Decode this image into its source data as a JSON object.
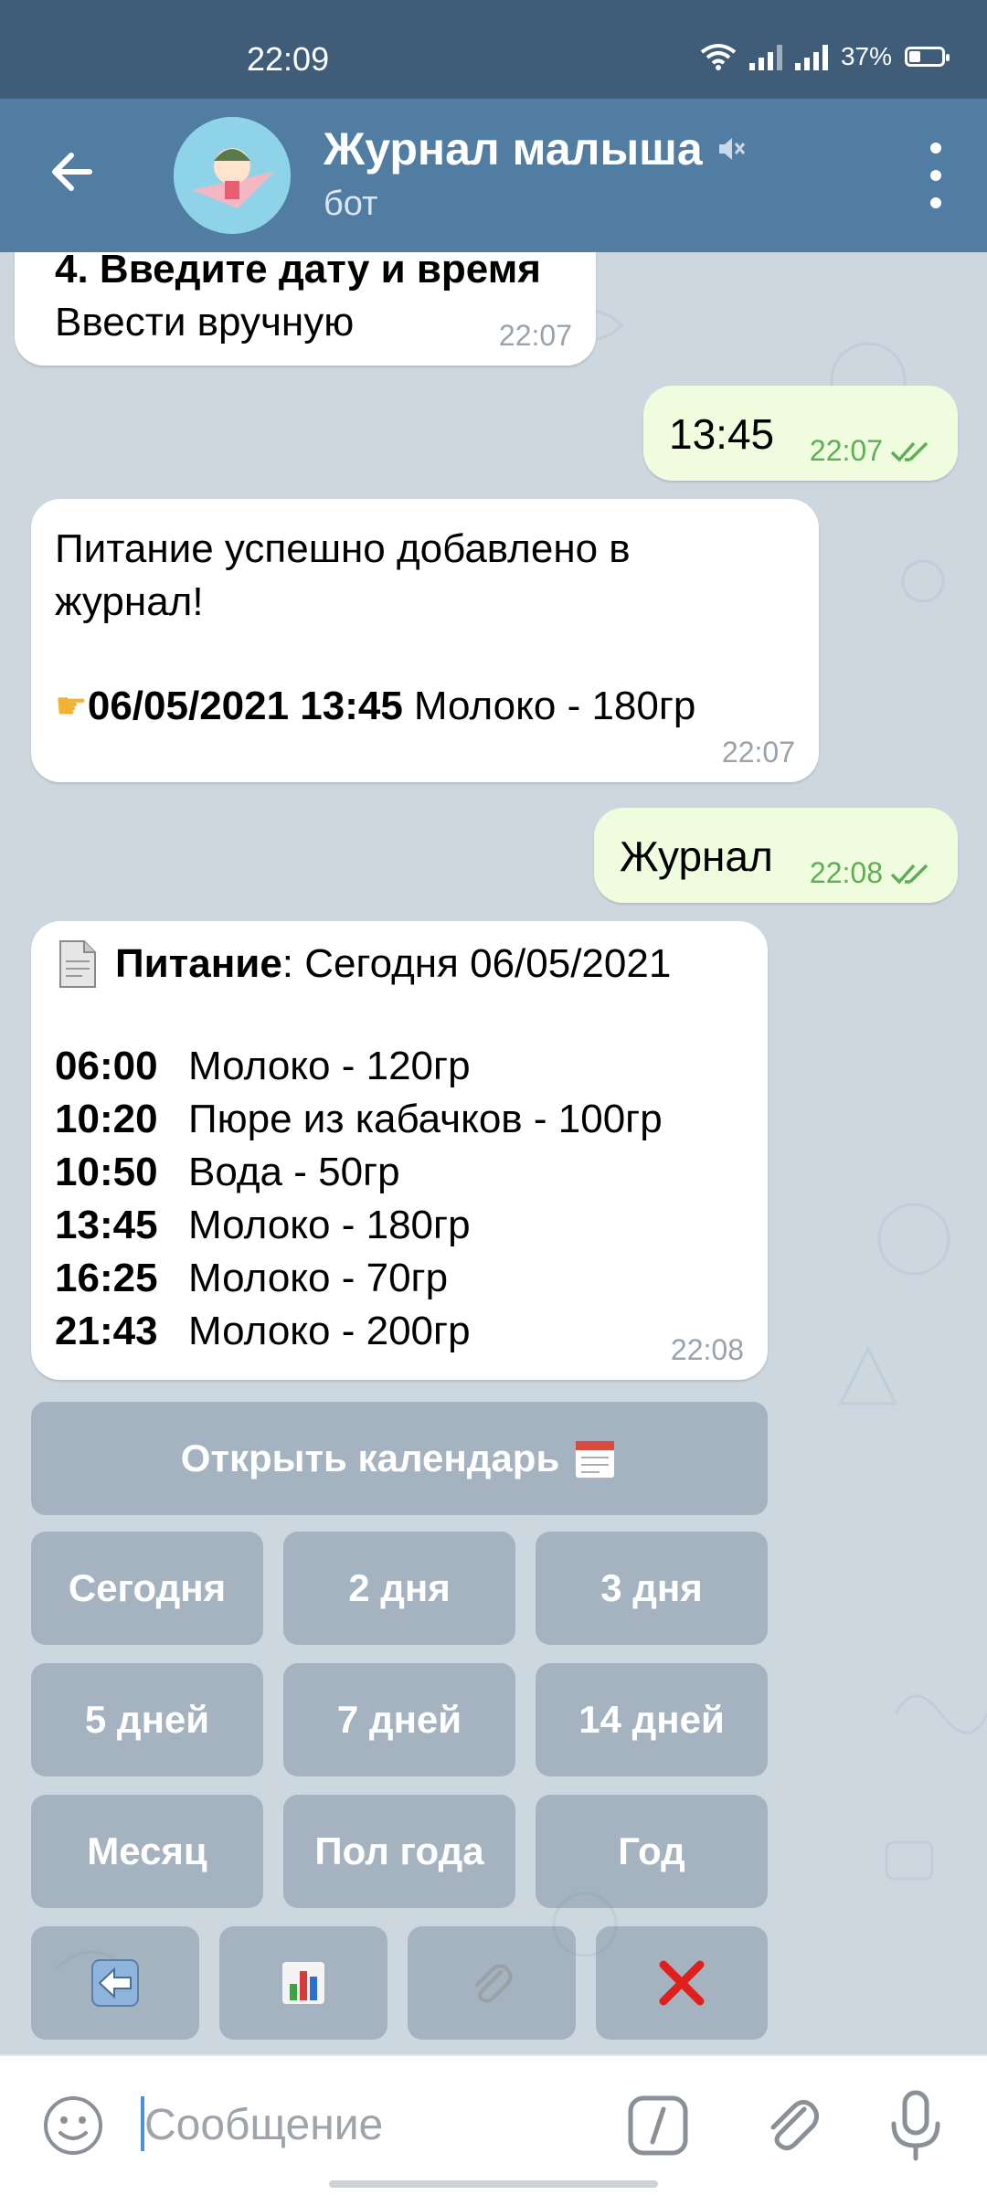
{
  "status_bar": {
    "time": "22:09",
    "battery": "37%"
  },
  "header": {
    "title": "Журнал малыша",
    "subtitle": "бот"
  },
  "messages": [
    {
      "line1": "4. Введите дату и время",
      "line2": "Ввести вручную",
      "time": "22:07"
    },
    {
      "text": "13:45",
      "time": "22:07"
    },
    {
      "line1": "Питание успешно добавлено в",
      "line2": "журнал!",
      "date": "06/05/2021 13:45",
      "item": " Молоко - 180гр",
      "time": "22:07"
    },
    {
      "text": "Журнал",
      "time": "22:08"
    },
    {
      "heading": "Питание",
      "heading_rest": ": Сегодня 06/05/2021",
      "entries": [
        {
          "time": "06:00",
          "item": "Молоко - 120гр"
        },
        {
          "time": "10:20",
          "item": "Пюре из кабачков - 100гр"
        },
        {
          "time": "10:50",
          "item": "Вода - 50гр"
        },
        {
          "time": "13:45",
          "item": "Молоко - 180гр"
        },
        {
          "time": "16:25",
          "item": "Молоко - 70гр"
        },
        {
          "time": "21:43",
          "item": "Молоко - 200гр"
        }
      ],
      "time": "22:08"
    }
  ],
  "keyboard": {
    "calendar": "Открыть календарь",
    "row1": [
      "Сегодня",
      "2 дня",
      "3 дня"
    ],
    "row2": [
      "5 дней",
      "7 дней",
      "14 дней"
    ],
    "row3": [
      "Месяц",
      "Пол года",
      "Год"
    ]
  },
  "input": {
    "placeholder": "Сообщение"
  },
  "colors": {
    "header": "#517da2",
    "statusbar": "#3f5c79",
    "outgoing_bubble": "#effdde",
    "incoming_bubble": "#ffffff",
    "read_check": "#5fae57"
  }
}
